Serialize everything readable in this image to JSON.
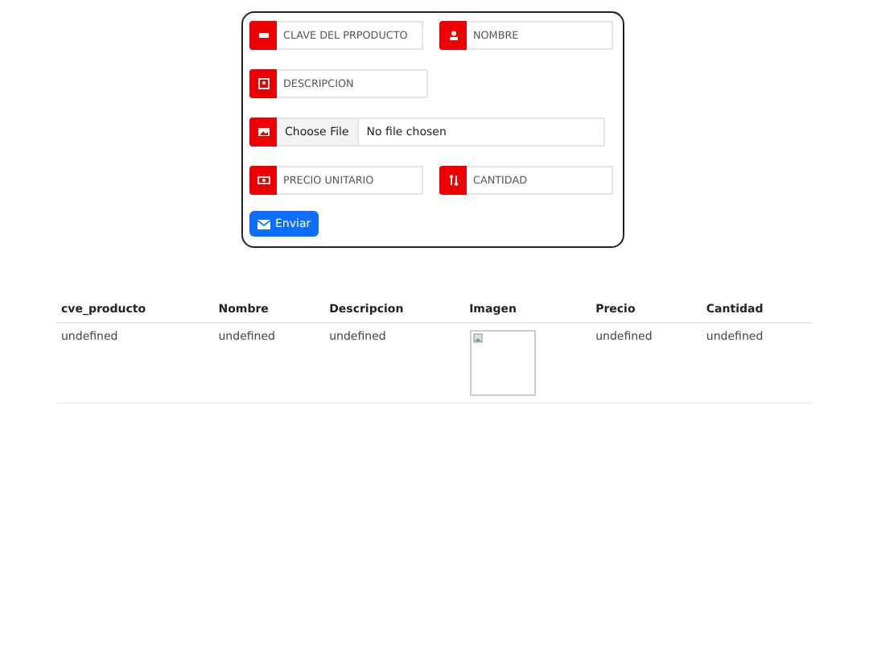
{
  "form": {
    "rows": [
      {
        "fields": [
          {
            "kind": "text",
            "placeholder": "CLAVE DEL PRPODUCTO"
          },
          {
            "kind": "text",
            "placeholder": "NOMBRE"
          }
        ]
      },
      {
        "fields": [
          {
            "kind": "text",
            "placeholder": "DESCRIPCION"
          }
        ]
      },
      {
        "fields": [
          {
            "kind": "file",
            "button": "Choose File",
            "status": "No file chosen"
          }
        ]
      },
      {
        "fields": [
          {
            "kind": "text",
            "placeholder": "PRECIO UNITARIO"
          },
          {
            "kind": "text",
            "placeholder": "CANTIDAD"
          }
        ]
      }
    ],
    "submit": "Enviar"
  },
  "table": {
    "columns": [
      "cve_producto",
      "Nombre",
      "Descripcion",
      "Imagen",
      "Precio",
      "Cantidad"
    ],
    "rows": [
      {
        "cells": [
          {
            "kind": "text",
            "text": "undefined"
          },
          {
            "kind": "text",
            "text": "undefined"
          },
          {
            "kind": "text",
            "text": "undefined"
          },
          {
            "kind": "image"
          },
          {
            "kind": "text",
            "text": "undefined"
          },
          {
            "kind": "text",
            "text": "undefined"
          }
        ]
      }
    ]
  }
}
